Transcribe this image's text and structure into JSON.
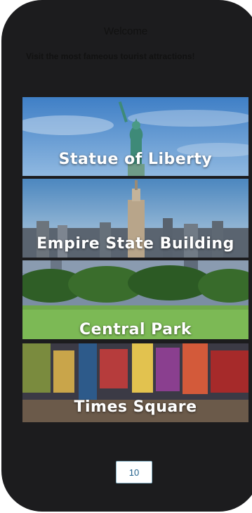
{
  "header": {
    "title": "Welcome",
    "subtitle": "Visit the most fameous tourist attractions!"
  },
  "attractions": [
    {
      "label": "Statue of Liberty"
    },
    {
      "label": "Empire State Building"
    },
    {
      "label": "Central Park"
    },
    {
      "label": "Times Square"
    }
  ],
  "pager": {
    "value": "10"
  }
}
